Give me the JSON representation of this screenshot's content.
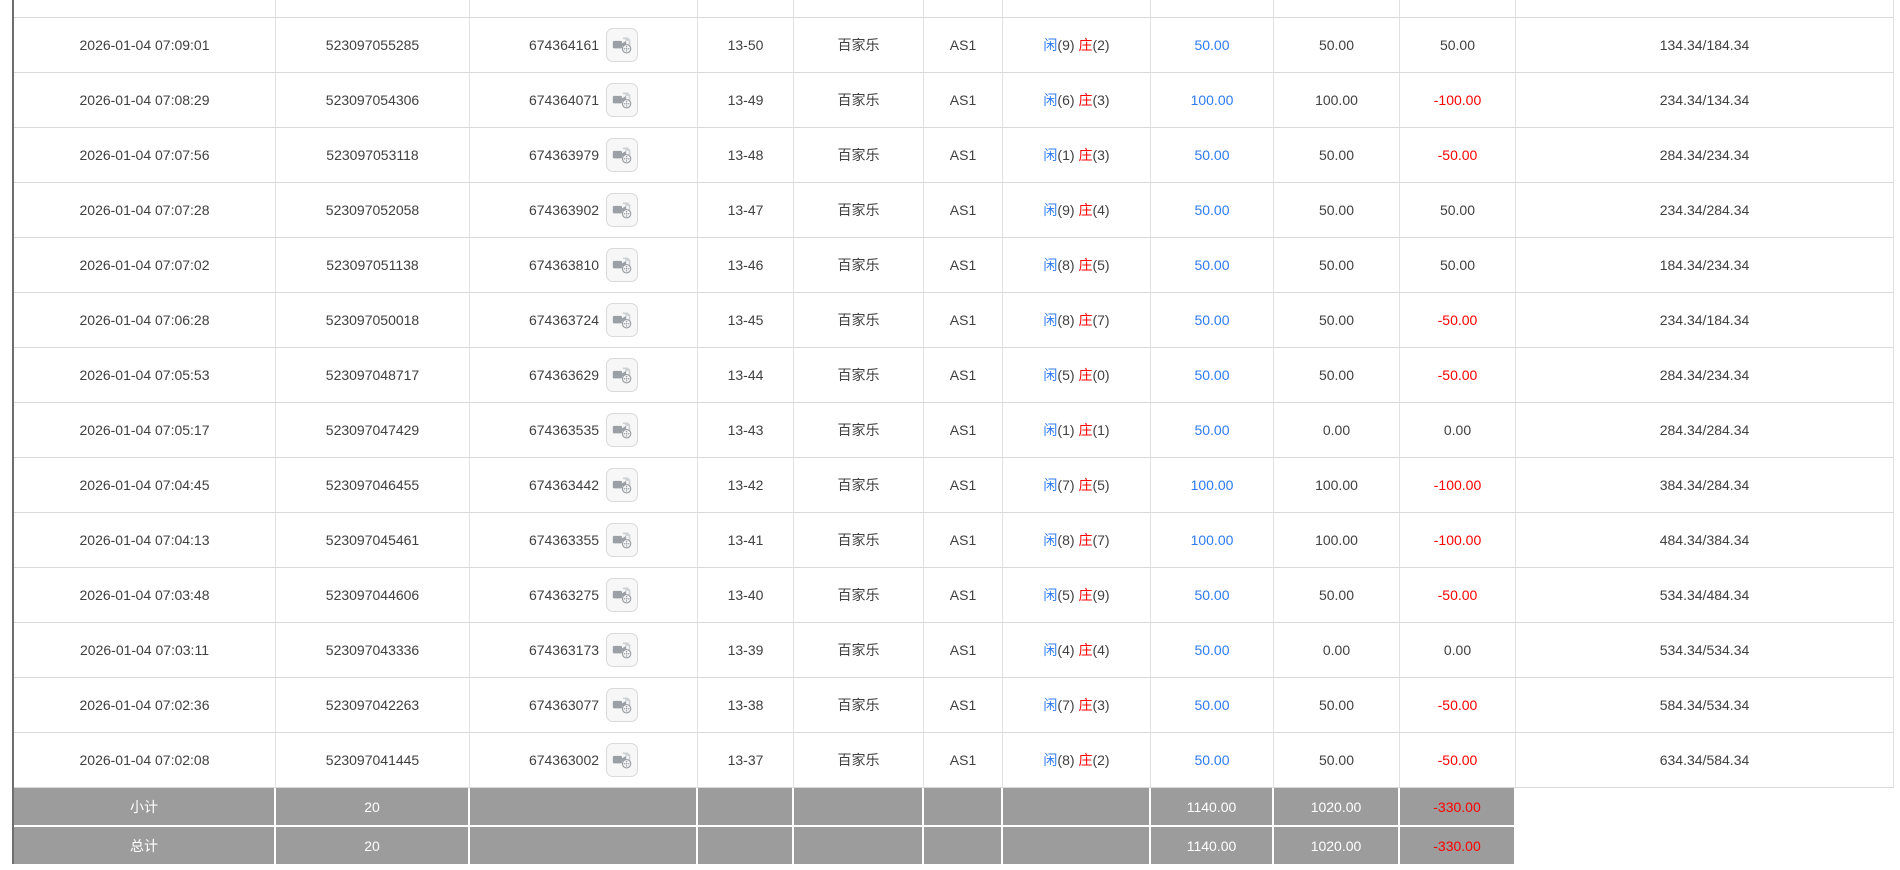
{
  "labels": {
    "player": "闲",
    "banker": "庄"
  },
  "icons": {
    "video": "video-replay-icon"
  },
  "colors": {
    "link_blue": "#2d7bf0",
    "loss_red": "#ff0000",
    "summary_gray": "#9c9c9c"
  },
  "rows": [
    {
      "time": "2026-01-04 07:09:01",
      "order_id": "523097055285",
      "game_id": "674364161",
      "round": "13-50",
      "game_type": "百家乐",
      "table_name": "AS1",
      "player": "9",
      "banker": "2",
      "bet": "50.00",
      "valid": "50.00",
      "winloss": "50.00",
      "balance": "134.34/184.34"
    },
    {
      "time": "2026-01-04 07:08:29",
      "order_id": "523097054306",
      "game_id": "674364071",
      "round": "13-49",
      "game_type": "百家乐",
      "table_name": "AS1",
      "player": "6",
      "banker": "3",
      "bet": "100.00",
      "valid": "100.00",
      "winloss": "-100.00",
      "balance": "234.34/134.34"
    },
    {
      "time": "2026-01-04 07:07:56",
      "order_id": "523097053118",
      "game_id": "674363979",
      "round": "13-48",
      "game_type": "百家乐",
      "table_name": "AS1",
      "player": "1",
      "banker": "3",
      "bet": "50.00",
      "valid": "50.00",
      "winloss": "-50.00",
      "balance": "284.34/234.34"
    },
    {
      "time": "2026-01-04 07:07:28",
      "order_id": "523097052058",
      "game_id": "674363902",
      "round": "13-47",
      "game_type": "百家乐",
      "table_name": "AS1",
      "player": "9",
      "banker": "4",
      "bet": "50.00",
      "valid": "50.00",
      "winloss": "50.00",
      "balance": "234.34/284.34"
    },
    {
      "time": "2026-01-04 07:07:02",
      "order_id": "523097051138",
      "game_id": "674363810",
      "round": "13-46",
      "game_type": "百家乐",
      "table_name": "AS1",
      "player": "8",
      "banker": "5",
      "bet": "50.00",
      "valid": "50.00",
      "winloss": "50.00",
      "balance": "184.34/234.34"
    },
    {
      "time": "2026-01-04 07:06:28",
      "order_id": "523097050018",
      "game_id": "674363724",
      "round": "13-45",
      "game_type": "百家乐",
      "table_name": "AS1",
      "player": "8",
      "banker": "7",
      "bet": "50.00",
      "valid": "50.00",
      "winloss": "-50.00",
      "balance": "234.34/184.34"
    },
    {
      "time": "2026-01-04 07:05:53",
      "order_id": "523097048717",
      "game_id": "674363629",
      "round": "13-44",
      "game_type": "百家乐",
      "table_name": "AS1",
      "player": "5",
      "banker": "0",
      "bet": "50.00",
      "valid": "50.00",
      "winloss": "-50.00",
      "balance": "284.34/234.34"
    },
    {
      "time": "2026-01-04 07:05:17",
      "order_id": "523097047429",
      "game_id": "674363535",
      "round": "13-43",
      "game_type": "百家乐",
      "table_name": "AS1",
      "player": "1",
      "banker": "1",
      "bet": "50.00",
      "valid": "0.00",
      "winloss": "0.00",
      "balance": "284.34/284.34"
    },
    {
      "time": "2026-01-04 07:04:45",
      "order_id": "523097046455",
      "game_id": "674363442",
      "round": "13-42",
      "game_type": "百家乐",
      "table_name": "AS1",
      "player": "7",
      "banker": "5",
      "bet": "100.00",
      "valid": "100.00",
      "winloss": "-100.00",
      "balance": "384.34/284.34"
    },
    {
      "time": "2026-01-04 07:04:13",
      "order_id": "523097045461",
      "game_id": "674363355",
      "round": "13-41",
      "game_type": "百家乐",
      "table_name": "AS1",
      "player": "8",
      "banker": "7",
      "bet": "100.00",
      "valid": "100.00",
      "winloss": "-100.00",
      "balance": "484.34/384.34"
    },
    {
      "time": "2026-01-04 07:03:48",
      "order_id": "523097044606",
      "game_id": "674363275",
      "round": "13-40",
      "game_type": "百家乐",
      "table_name": "AS1",
      "player": "5",
      "banker": "9",
      "bet": "50.00",
      "valid": "50.00",
      "winloss": "-50.00",
      "balance": "534.34/484.34"
    },
    {
      "time": "2026-01-04 07:03:11",
      "order_id": "523097043336",
      "game_id": "674363173",
      "round": "13-39",
      "game_type": "百家乐",
      "table_name": "AS1",
      "player": "4",
      "banker": "4",
      "bet": "50.00",
      "valid": "0.00",
      "winloss": "0.00",
      "balance": "534.34/534.34"
    },
    {
      "time": "2026-01-04 07:02:36",
      "order_id": "523097042263",
      "game_id": "674363077",
      "round": "13-38",
      "game_type": "百家乐",
      "table_name": "AS1",
      "player": "7",
      "banker": "3",
      "bet": "50.00",
      "valid": "50.00",
      "winloss": "-50.00",
      "balance": "584.34/534.34"
    },
    {
      "time": "2026-01-04 07:02:08",
      "order_id": "523097041445",
      "game_id": "674363002",
      "round": "13-37",
      "game_type": "百家乐",
      "table_name": "AS1",
      "player": "8",
      "banker": "2",
      "bet": "50.00",
      "valid": "50.00",
      "winloss": "-50.00",
      "balance": "634.34/584.34"
    }
  ],
  "summary": {
    "subtotal": {
      "label": "小计",
      "count": "20",
      "bet": "1140.00",
      "valid": "1020.00",
      "winloss": "-330.00"
    },
    "total": {
      "label": "总计",
      "count": "20",
      "bet": "1140.00",
      "valid": "1020.00",
      "winloss": "-330.00"
    }
  }
}
